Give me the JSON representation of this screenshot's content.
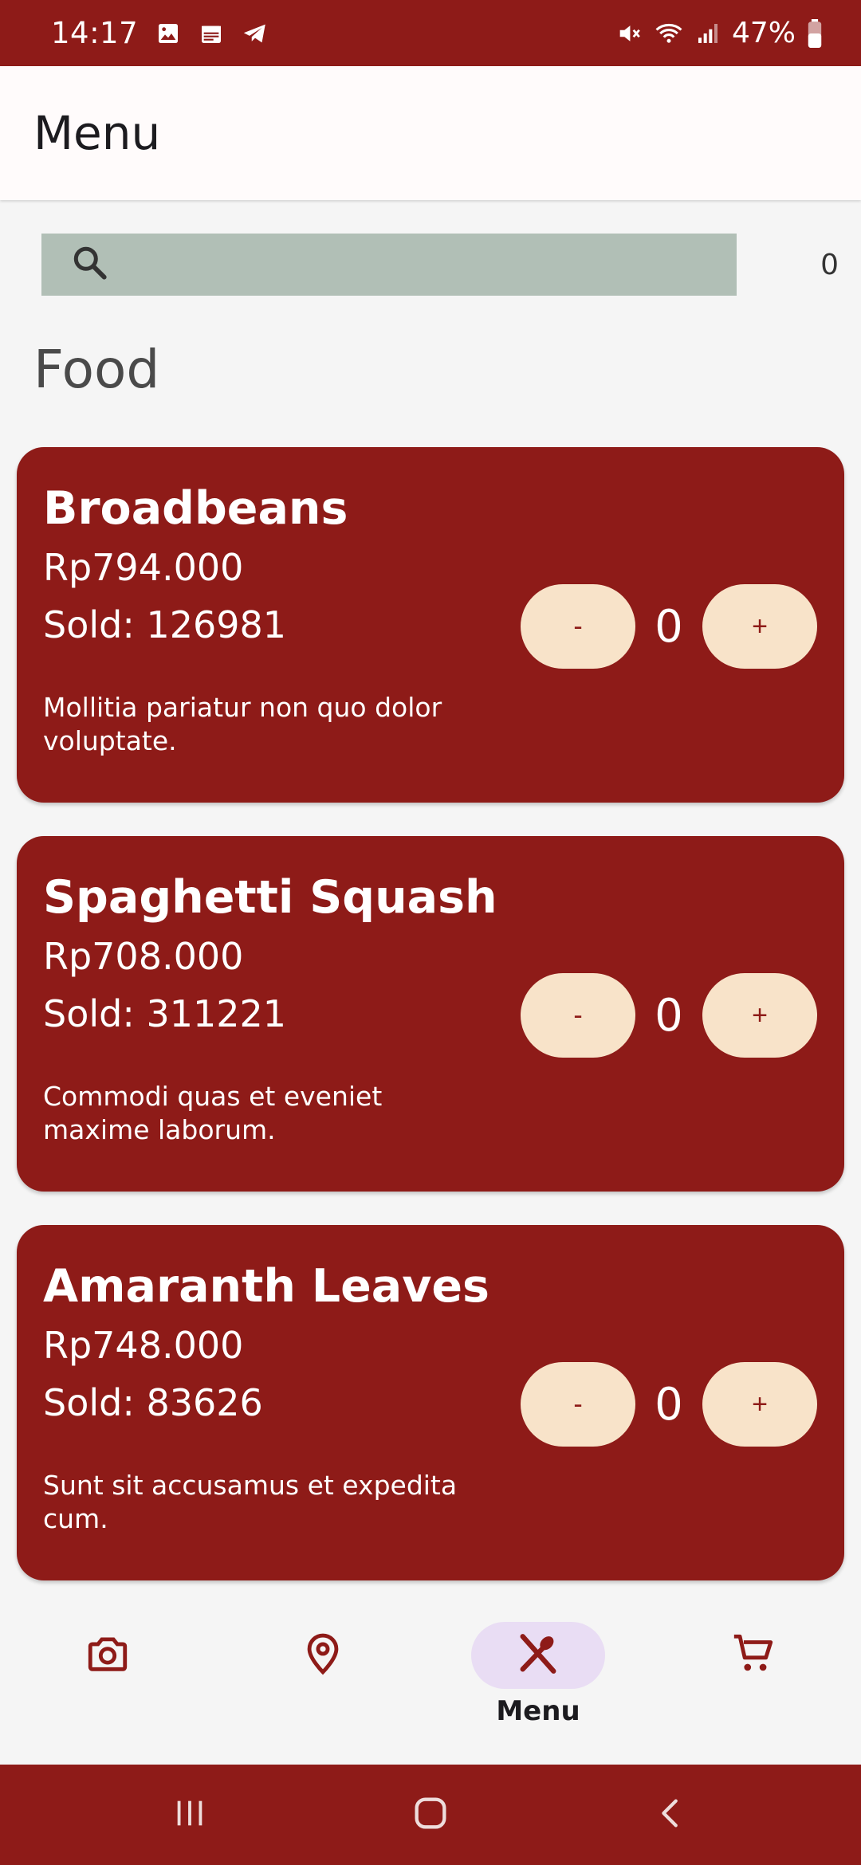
{
  "status_bar": {
    "time": "14:17",
    "battery": "47%",
    "icons": [
      "gallery-icon",
      "calendar-icon",
      "telegram-icon",
      "mute-icon",
      "wifi-icon",
      "signal-icon",
      "battery-icon"
    ]
  },
  "app_bar": {
    "title": "Menu"
  },
  "search": {
    "placeholder": "",
    "cart_count": "0"
  },
  "section": {
    "title": "Food"
  },
  "items": [
    {
      "name": "Broadbeans",
      "price": "Rp794.000",
      "sold": "Sold: 126981",
      "description": "Mollitia pariatur non quo dolor voluptate.",
      "quantity": "0",
      "minus_label": "-",
      "plus_label": "+"
    },
    {
      "name": "Spaghetti Squash",
      "price": "Rp708.000",
      "sold": "Sold: 311221",
      "description": "Commodi quas et eveniet maxime laborum.",
      "quantity": "0",
      "minus_label": "-",
      "plus_label": "+"
    },
    {
      "name": "Amaranth Leaves",
      "price": "Rp748.000",
      "sold": "Sold: 83626",
      "description": "Sunt sit accusamus et expedita cum.",
      "quantity": "0",
      "minus_label": "-",
      "plus_label": "+"
    }
  ],
  "bottom_nav": {
    "items": [
      {
        "icon": "camera-icon",
        "label": ""
      },
      {
        "icon": "location-icon",
        "label": ""
      },
      {
        "icon": "restaurant-icon",
        "label": "Menu",
        "active": true
      },
      {
        "icon": "cart-icon",
        "label": ""
      }
    ]
  },
  "colors": {
    "primary": "#8e1b18",
    "button_fill": "#f8e3c9",
    "search_fill": "#b1bfb6",
    "nav_active": "#e9ddf4"
  }
}
